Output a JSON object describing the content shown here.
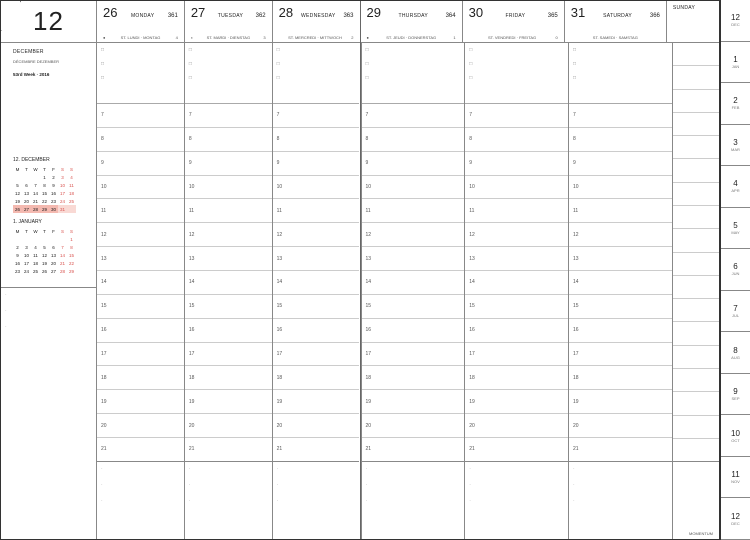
{
  "month": {
    "number": "12",
    "name": "DECEMBER",
    "sub": "DÉCEMBRE  DEZEMBER",
    "week": "53rd Week · 2016"
  },
  "days": [
    {
      "num": "26",
      "name": "MONDAY",
      "sub": "ST. LUNDI · MONTAG",
      "badge1": "361",
      "badge2": "4",
      "icon": "●"
    },
    {
      "num": "27",
      "name": "TUESDAY",
      "sub": "ST. MARDI · DIENSTAG",
      "badge1": "362",
      "badge2": "3",
      "icon": "◐"
    },
    {
      "num": "28",
      "name": "WEDNESDAY",
      "sub": "ST. MERCREDI · MITTWOCH",
      "badge1": "363",
      "badge2": "2",
      "icon": ""
    },
    {
      "num": "29",
      "name": "THURSDAY",
      "sub": "ST. JEUDI · DONNERSTAG",
      "badge1": "364",
      "badge2": "1",
      "icon": "●"
    },
    {
      "num": "30",
      "name": "FRIDAY",
      "sub": "ST. VENDREDI · FREITAG",
      "badge1": "365",
      "badge2": "0",
      "icon": ""
    },
    {
      "num": "31",
      "name": "SATURDAY",
      "sub": "ST. SAMEDI · SAMSTAG",
      "badge1": "366",
      "badge2": "",
      "icon": ""
    }
  ],
  "sunday": {
    "label": "SUNDAY"
  },
  "hours": [
    "7",
    "8",
    "9",
    "10",
    "11",
    "12",
    "13",
    "14",
    "15",
    "16",
    "17",
    "18",
    "19",
    "20",
    "21"
  ],
  "notes_marker": "□",
  "dot_marker": "·",
  "minicals": [
    {
      "title": "12. DECEMBER",
      "wk": [
        "M",
        "T",
        "W",
        "T",
        "F",
        "S",
        "S"
      ],
      "rows": [
        [
          "",
          "",
          "",
          "1",
          "2",
          "3",
          "4"
        ],
        [
          "5",
          "6",
          "7",
          "8",
          "9",
          "10",
          "11"
        ],
        [
          "12",
          "13",
          "14",
          "15",
          "16",
          "17",
          "18"
        ],
        [
          "19",
          "20",
          "21",
          "22",
          "23",
          "24",
          "25"
        ],
        [
          "26",
          "27",
          "28",
          "29",
          "30",
          "31",
          ""
        ]
      ],
      "highlight_row": 4
    },
    {
      "title": "1. JANUARY",
      "wk": [
        "M",
        "T",
        "W",
        "T",
        "F",
        "S",
        "S"
      ],
      "rows": [
        [
          "",
          "",
          "",
          "",
          "",
          "",
          "1"
        ],
        [
          "2",
          "3",
          "4",
          "5",
          "6",
          "7",
          "8"
        ],
        [
          "9",
          "10",
          "11",
          "12",
          "13",
          "14",
          "15"
        ],
        [
          "16",
          "17",
          "18",
          "19",
          "20",
          "21",
          "22"
        ],
        [
          "23",
          "24",
          "25",
          "26",
          "27",
          "28",
          "29"
        ]
      ],
      "highlight_row": -1
    }
  ],
  "tabs": [
    {
      "n": "12",
      "s": "DEC"
    },
    {
      "n": "1",
      "s": "JAN"
    },
    {
      "n": "2",
      "s": "FEB"
    },
    {
      "n": "3",
      "s": "MAR"
    },
    {
      "n": "4",
      "s": "APR"
    },
    {
      "n": "5",
      "s": "MAY"
    },
    {
      "n": "6",
      "s": "JUN"
    },
    {
      "n": "7",
      "s": "JUL"
    },
    {
      "n": "8",
      "s": "AUG"
    },
    {
      "n": "9",
      "s": "SEP"
    },
    {
      "n": "10",
      "s": "OCT"
    },
    {
      "n": "11",
      "s": "NOV"
    },
    {
      "n": "12",
      "s": "DEC"
    }
  ],
  "brand": "MOMENTUM"
}
